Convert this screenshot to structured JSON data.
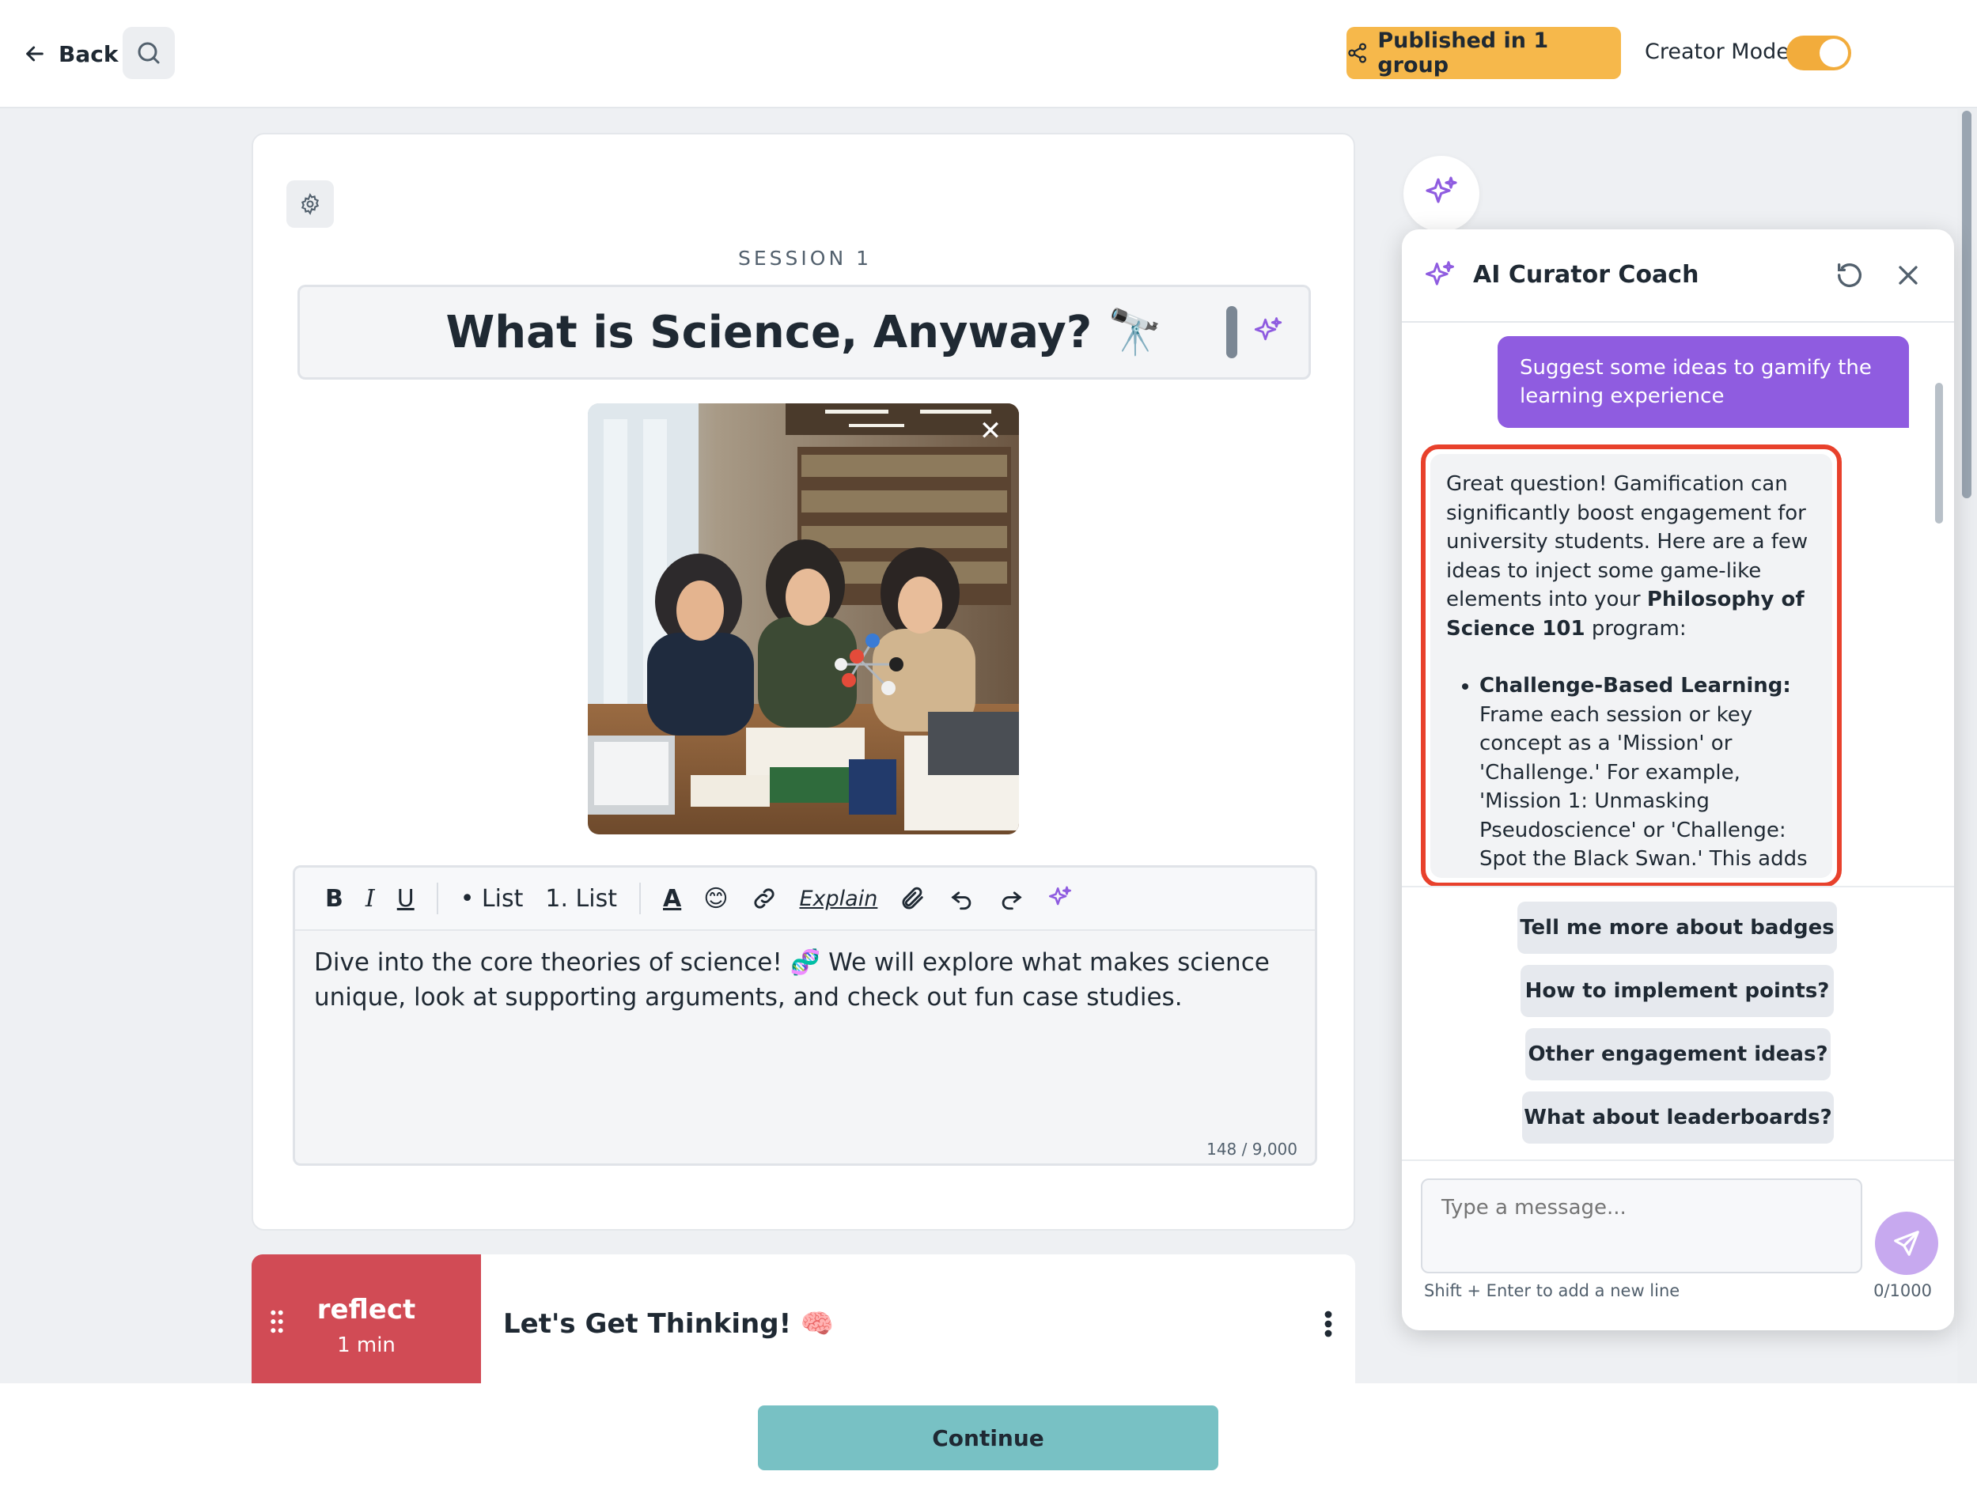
{
  "topbar": {
    "back_label": "Back",
    "published_label": "Published in 1 group",
    "creator_mode_label": "Creator Mode",
    "creator_mode_on": true
  },
  "session": {
    "label": "SESSION 1",
    "title": "What is Science, Anyway? 🔭"
  },
  "editor": {
    "toolbar": {
      "bold": "B",
      "italic": "I",
      "underline": "U",
      "bullet_list": "• List",
      "numbered_list": "1. List",
      "text_color": "A",
      "explain": "Explain"
    },
    "body": "Dive into the core theories of science! 🧬 We will explore what makes science unique, look at supporting arguments, and check out fun case studies.",
    "char_count": "148 / 9,000"
  },
  "activity": {
    "type": "reflect",
    "duration": "1 min",
    "title": "Let's Get Thinking! 🧠"
  },
  "footer": {
    "continue_label": "Continue"
  },
  "ai_panel": {
    "title": "AI Curator Coach",
    "user_message": "Suggest some ideas to gamify the learning experience",
    "reply": {
      "intro_1": "Great question! Gamification can significantly boost engagement for university students. Here are a few ideas to inject some game-like elements into your ",
      "intro_bold": "Philosophy of Science 101",
      "intro_2": " program:",
      "bullet_bold": "Challenge-Based Learning:",
      "bullet_text": " Frame each session or key concept as a 'Mission' or 'Challenge.' For example, 'Mission 1: Unmasking Pseudoscience' or 'Challenge: Spot the Black Swan.' This adds a sense of purpose and adventure."
    },
    "suggestions": [
      "Tell me more about badges",
      "How to implement points?",
      "Other engagement ideas?",
      "What about leaderboards?"
    ],
    "input_placeholder": "Type a message...",
    "input_hint": "Shift + Enter to add a new line",
    "input_count": "0/1000"
  },
  "colors": {
    "accent_orange": "#f6b84b",
    "ai_purple": "#8f5ce0",
    "reflect_red": "#d14b55",
    "continue_teal": "#78c1c4",
    "highlight_red": "#e8412c"
  }
}
